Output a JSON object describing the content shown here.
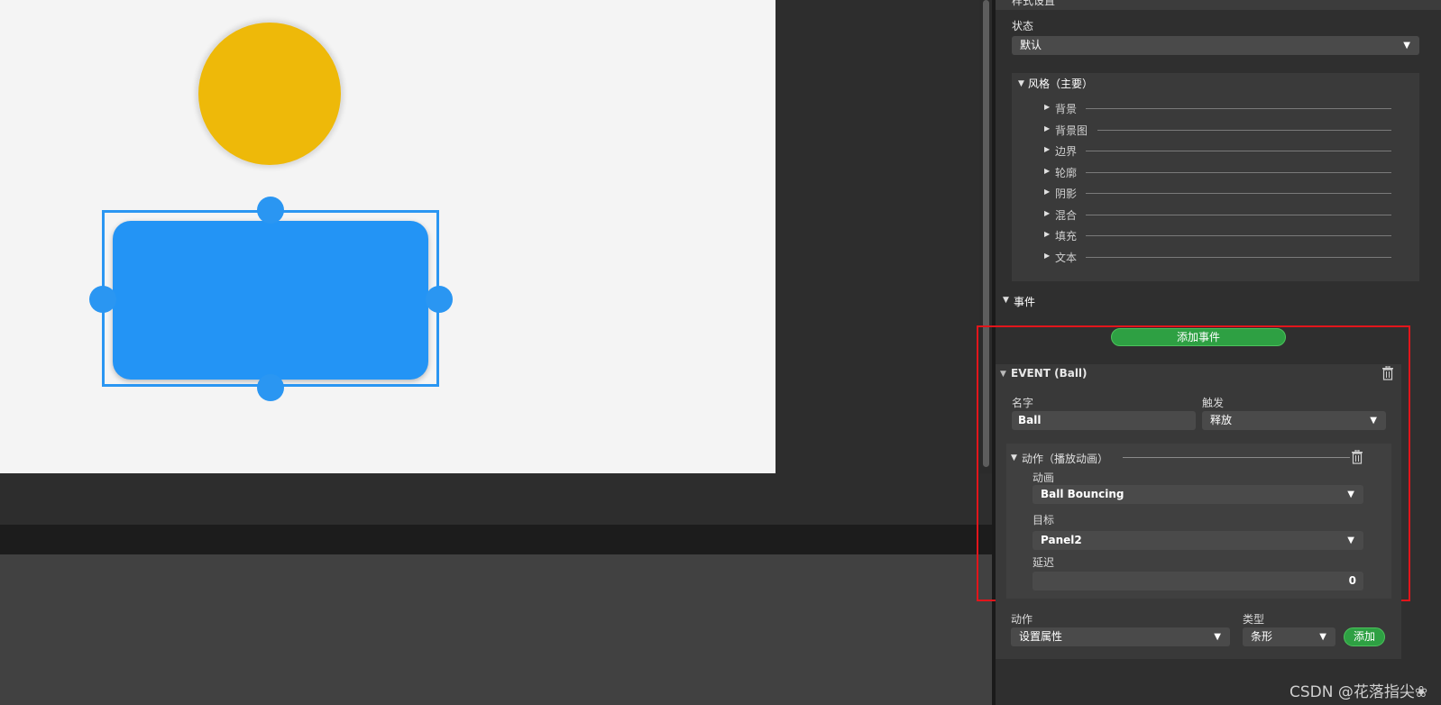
{
  "inspector": {
    "header_cut": "样式设置",
    "state_label": "状态",
    "state_value": "默认",
    "style_group": "风格（主要）",
    "style_items": [
      "背景",
      "背景图",
      "边界",
      "轮廓",
      "阴影",
      "混合",
      "填充",
      "文本"
    ],
    "events_header": "事件",
    "add_event_button": "添加事件",
    "event": {
      "title": "EVENT (Ball)",
      "name_label": "名字",
      "name_value": "Ball",
      "trigger_label": "触发",
      "trigger_value": "释放",
      "action": {
        "title": "动作（播放动画）",
        "animation_label": "动画",
        "animation_value": "Ball Bouncing",
        "target_label": "目标",
        "target_value": "Panel2",
        "delay_label": "延迟",
        "delay_value": "0"
      }
    },
    "footer": {
      "action_label": "动作",
      "action_value": "设置属性",
      "type_label": "类型",
      "type_value": "条形",
      "add_button": "添加"
    }
  },
  "watermark": "CSDN @花落指尖❀",
  "colors": {
    "ball": "#eeb909",
    "panel": "#2394f5",
    "selection": "#2a96f2",
    "green_button": "#2ea043",
    "highlight_frame": "#e2151b"
  }
}
